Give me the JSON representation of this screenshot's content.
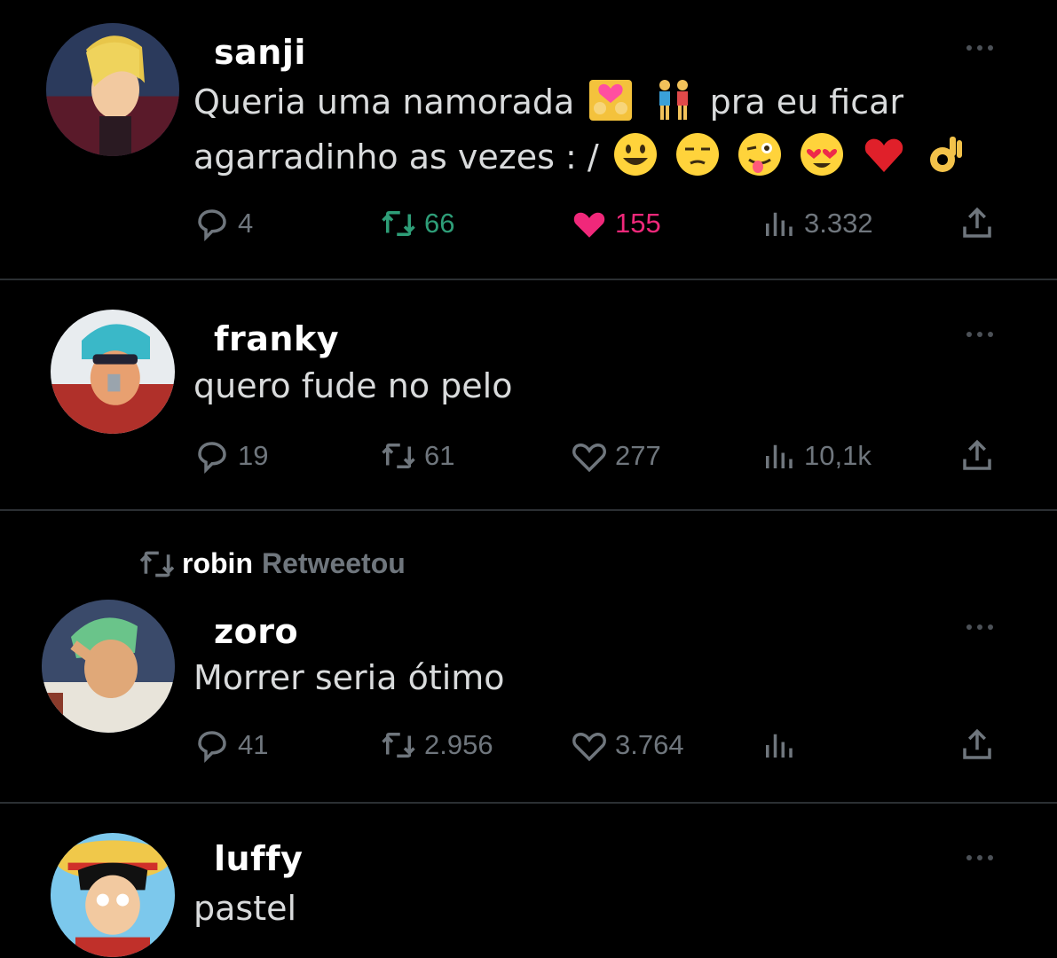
{
  "tweets": [
    {
      "user": "sanji",
      "text_line1": "Queria uma namorada",
      "text_mid": "pra eu ficar",
      "text_line2": "agarradinho as vezes : /",
      "replies": "4",
      "retweets": "66",
      "likes": "155",
      "views": "3.332",
      "retweeted": true,
      "liked": true,
      "emojis": [
        "couple-with-heart",
        "holding-hands",
        "smiley",
        "unamused",
        "winking-tongue",
        "heart-eyes",
        "red-heart",
        "ok-hand"
      ]
    },
    {
      "user": "franky",
      "text_line1": "quero fude no pelo",
      "replies": "19",
      "retweets": "61",
      "likes": "277",
      "views": "10,1k"
    },
    {
      "retweet_by": "robin",
      "retweet_verb": "Retweetou",
      "user": "zoro",
      "text_line1": "Morrer seria ótimo",
      "replies": "41",
      "retweets": "2.956",
      "likes": "3.764",
      "views": ""
    },
    {
      "user": "luffy",
      "text_line1": "pastel"
    }
  ],
  "colors": {
    "background": "#000000",
    "text": "#d9dbdc",
    "muted": "#6f767d",
    "retweet_active": "#2e9e78",
    "like_active": "#f0287a"
  },
  "icons": [
    "reply-icon",
    "retweet-icon",
    "like-icon",
    "views-icon",
    "share-icon",
    "more-icon"
  ]
}
